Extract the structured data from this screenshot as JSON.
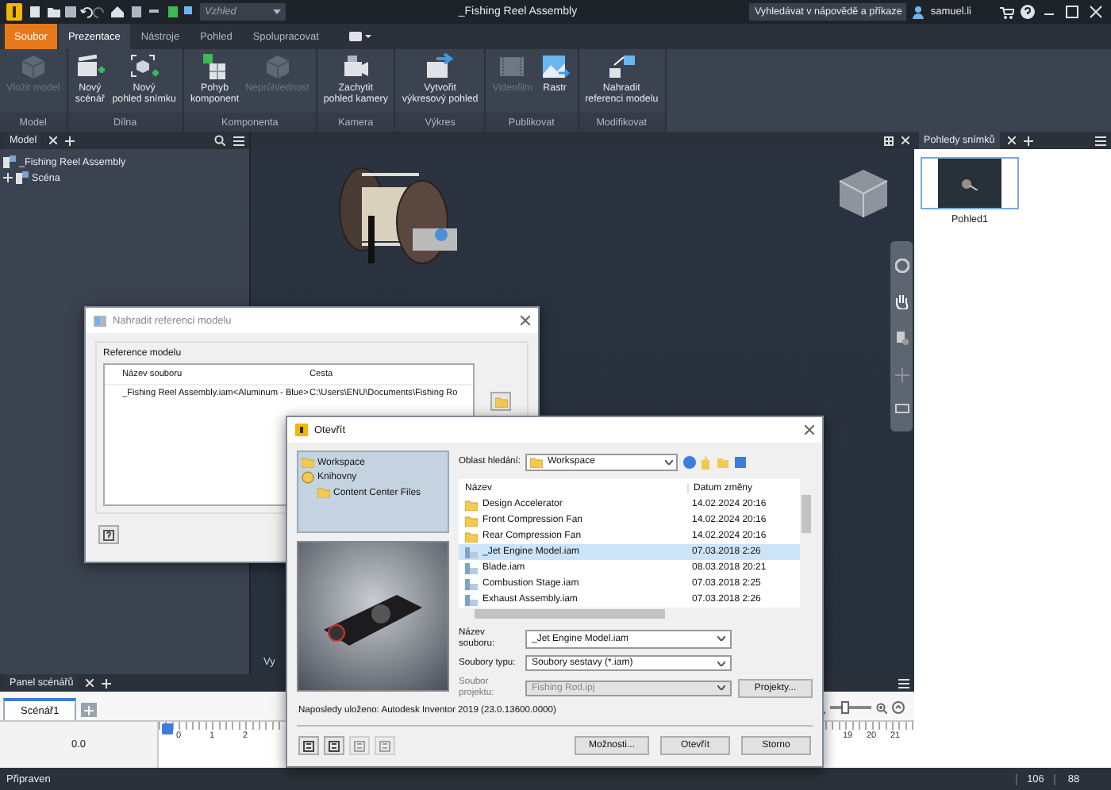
{
  "app": {
    "title": "_Fishing Reel Assembly",
    "appearance": "Vzhled",
    "help_search": "Vyhledávat v nápovědě a příkaze",
    "user": "samuel.li"
  },
  "ribbon_tabs": [
    {
      "label": "Soubor",
      "kind": "file",
      "selected": false
    },
    {
      "label": "Prezentace",
      "kind": "tab",
      "selected": true
    },
    {
      "label": "Nástroje",
      "kind": "tab",
      "selected": false
    },
    {
      "label": "Pohled",
      "kind": "tab",
      "selected": false
    },
    {
      "label": "Spolupracovat",
      "kind": "tab",
      "selected": false
    }
  ],
  "ribbon_groups": [
    {
      "label": "Model",
      "buttons": [
        {
          "lines": [
            "Vložit model"
          ],
          "kind": "cube",
          "disabled": true
        }
      ]
    },
    {
      "label": "Dílna",
      "buttons": [
        {
          "lines": [
            "Nový",
            "scénář"
          ],
          "kind": "clapper",
          "disabled": false
        },
        {
          "lines": [
            "Nový",
            "pohled snímku"
          ],
          "kind": "frame",
          "disabled": false
        }
      ]
    },
    {
      "label": "Komponenta",
      "buttons": [
        {
          "lines": [
            "Pohyb",
            "komponent"
          ],
          "kind": "move",
          "disabled": false
        },
        {
          "lines": [
            "Neprůhlednost"
          ],
          "kind": "cube",
          "disabled": true
        }
      ]
    },
    {
      "label": "Kamera",
      "buttons": [
        {
          "lines": [
            "Zachytit",
            "pohled kamery"
          ],
          "kind": "camera",
          "disabled": false
        }
      ]
    },
    {
      "label": "Výkres",
      "buttons": [
        {
          "lines": [
            "Vytvořit",
            "výkresový pohled"
          ],
          "kind": "drawing",
          "disabled": false
        }
      ]
    },
    {
      "label": "Publikovat",
      "buttons": [
        {
          "lines": [
            "Videofilm"
          ],
          "kind": "film",
          "disabled": true
        },
        {
          "lines": [
            "Rastr"
          ],
          "kind": "raster",
          "disabled": false
        }
      ]
    },
    {
      "label": "Modifikovat",
      "buttons": [
        {
          "lines": [
            "Nahradit",
            "referenci modelu"
          ],
          "kind": "replace",
          "disabled": false
        }
      ]
    }
  ],
  "model_panel": {
    "tab": "Model",
    "tree": [
      {
        "label": "_Fishing Reel Assembly",
        "children": [
          {
            "label": "Scéna",
            "expanded": false
          }
        ]
      }
    ]
  },
  "viewport": {
    "label": "Vy"
  },
  "snapshot_panel": {
    "tab": "Pohledy snímků",
    "snapshots": [
      {
        "label": "Pohled1",
        "selected": true
      }
    ]
  },
  "storyboard_panel": {
    "tab": "Panel scénářů",
    "storyboards": [
      {
        "label": "Scénář1",
        "selected": true
      }
    ],
    "time": "0.0",
    "ruler_start": [
      "0",
      "1",
      "2"
    ],
    "ruler_end": [
      "19",
      "20",
      "21"
    ],
    "zoom": {
      "level": 0.35
    }
  },
  "status_bar": {
    "message": "Připraven",
    "cells": [
      "106",
      "88"
    ]
  },
  "replace_dialog": {
    "title": "Nahradit referenci modelu",
    "group": "Reference modelu",
    "columns": [
      "Název souboru",
      "Cesta"
    ],
    "rows": [
      [
        "_Fishing Reel Assembly.iam<Aluminum - Blue>",
        "C:\\Users\\ENU\\Documents\\Fishing Ro"
      ]
    ]
  },
  "open_dialog": {
    "title": "Otevřít",
    "places": [
      {
        "label": "Workspace",
        "kind": "folder"
      },
      {
        "label": "Knihovny",
        "kind": "library",
        "children": [
          {
            "label": "Content Center Files",
            "kind": "folder"
          }
        ]
      }
    ],
    "look_in_label": "Oblast hledání:",
    "look_in": "Workspace",
    "columns": [
      "Název",
      "Datum změny"
    ],
    "files": [
      {
        "name": "Design Accelerator",
        "date": "14.02.2024 20:16",
        "kind": "folder",
        "selected": false
      },
      {
        "name": "Front Compression Fan",
        "date": "14.02.2024 20:16",
        "kind": "folder",
        "selected": false
      },
      {
        "name": "Rear Compression Fan",
        "date": "14.02.2024 20:16",
        "kind": "folder",
        "selected": false
      },
      {
        "name": "_Jet Engine Model.iam",
        "date": "07.03.2018 2:26",
        "kind": "assembly",
        "selected": true
      },
      {
        "name": "Blade.iam",
        "date": "08.03.2018 20:21",
        "kind": "assembly",
        "selected": false
      },
      {
        "name": "Combustion Stage.iam",
        "date": "07.03.2018 2:25",
        "kind": "assembly",
        "selected": false
      },
      {
        "name": "Exhaust Assembly.iam",
        "date": "07.03.2018 2:26",
        "kind": "assembly",
        "selected": false
      }
    ],
    "fields": [
      {
        "label": "Název souboru:",
        "value": "_Jet Engine Model.iam",
        "disabled": false
      },
      {
        "label": "Soubory typu:",
        "value": "Soubory sestavy (*.iam)",
        "disabled": false
      },
      {
        "label": "Soubor projektu:",
        "value": "Fishing Rod.ipj",
        "disabled": true,
        "button": "Projekty..."
      }
    ],
    "info": "Naposledy uloženo: Autodesk Inventor 2019 (23.0.13600.0000)",
    "tools": [
      {
        "disabled": false
      },
      {
        "disabled": false
      },
      {
        "disabled": true
      },
      {
        "disabled": true
      }
    ],
    "buttons": [
      "Možnosti...",
      "Otevřít",
      "Storno"
    ]
  }
}
